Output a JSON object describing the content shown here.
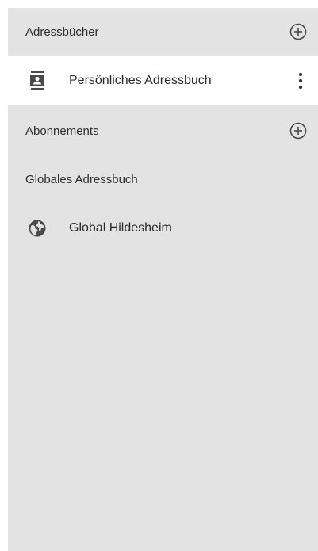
{
  "sidebar": {
    "address_books": {
      "header": "Adressbücher",
      "items": [
        {
          "label": "Persönliches Adressbuch",
          "icon": "contact-book-icon",
          "selected": true
        }
      ]
    },
    "subscriptions": {
      "header": "Abonnements"
    },
    "global_address_book": {
      "header": "Globales Adressbuch",
      "items": [
        {
          "label": "Global Hildesheim",
          "icon": "globe-icon",
          "selected": false
        }
      ]
    }
  },
  "colors": {
    "panel_bg": "#e3e3e3",
    "selected_bg": "#ffffff",
    "text": "#2b2b2b",
    "icon": "#4a4a4a"
  }
}
